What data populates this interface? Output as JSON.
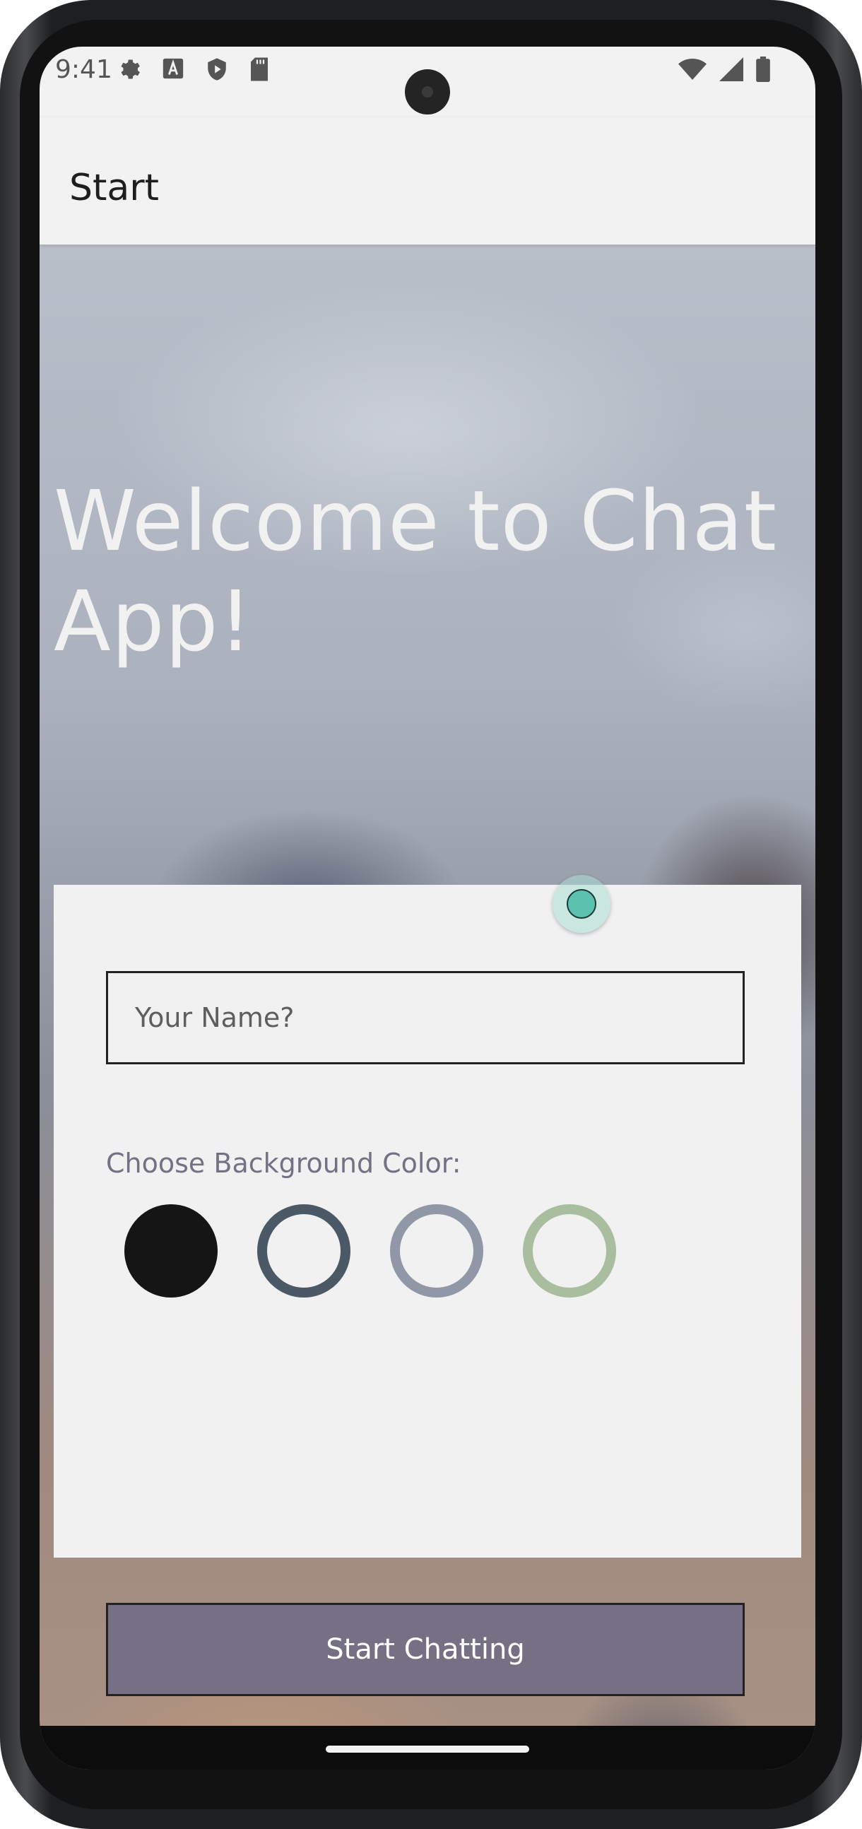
{
  "status_bar": {
    "time": "9:41",
    "left_icons": [
      "gear-icon",
      "font-a-icon",
      "shield-icon",
      "sd-card-icon"
    ],
    "right_icons": [
      "wifi-icon",
      "cellular-signal-icon",
      "battery-icon"
    ]
  },
  "app_bar": {
    "title": "Start"
  },
  "hero": {
    "welcome_text": "Welcome to Chat App!"
  },
  "form": {
    "name_input": {
      "placeholder": "Your Name?",
      "value": ""
    },
    "color_label": "Choose Background Color:",
    "colors": [
      {
        "hex": "#151515",
        "selected": true
      },
      {
        "hex": "#4b5866",
        "selected": false
      },
      {
        "hex": "#9097a6",
        "selected": false
      },
      {
        "hex": "#a9bd9f",
        "selected": false
      }
    ],
    "start_button_label": "Start Chatting"
  },
  "theme": {
    "accent": "#757083",
    "card_bg": "#f1f1f1",
    "touch_indicator": "#5cc1ae"
  }
}
